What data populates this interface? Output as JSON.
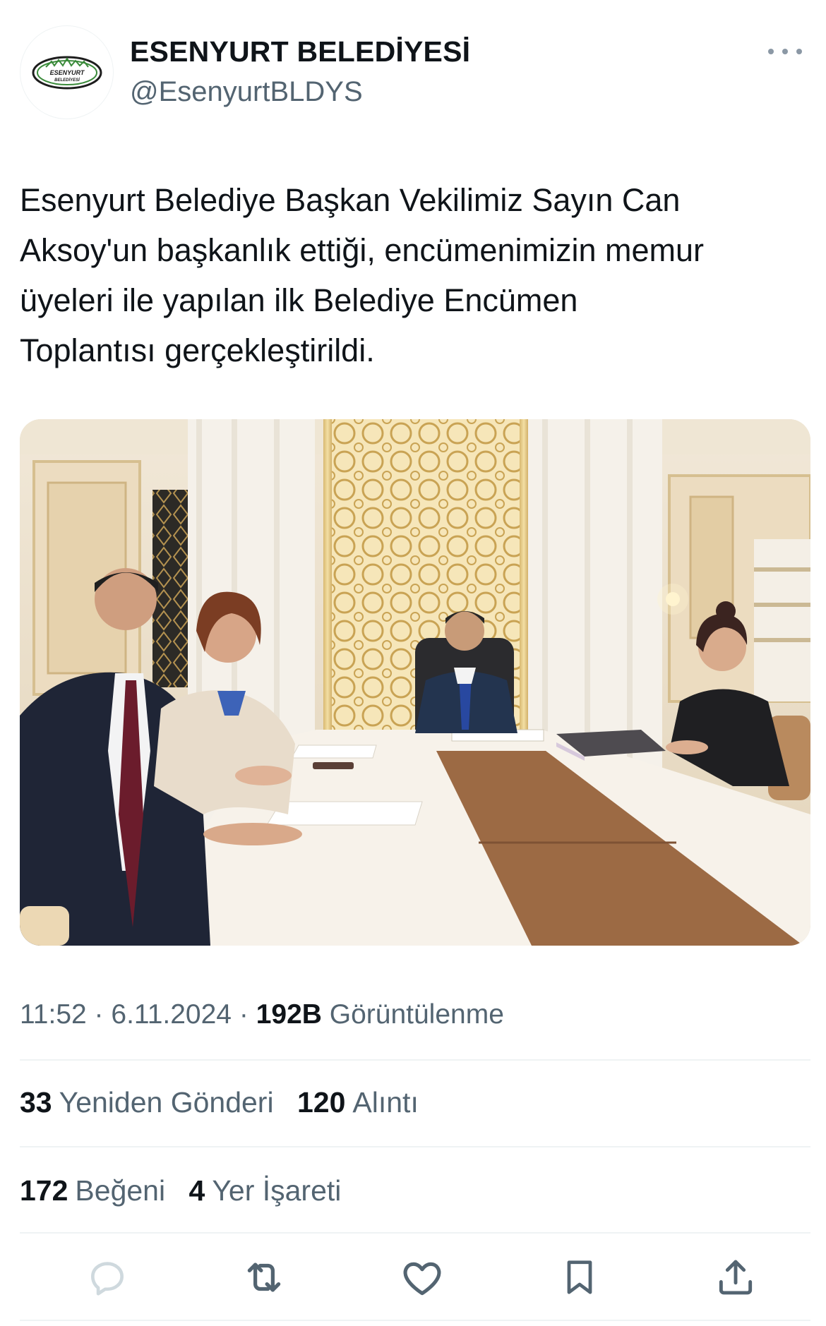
{
  "author": {
    "display_name": "ESENYURT BELEDİYESİ",
    "handle": "@EsenyurtBLDYS",
    "avatar_logo_line1": "ESENYURT",
    "avatar_logo_line2": "BELEDİYESİ"
  },
  "tweet": {
    "text": "Esenyurt Belediye Başkan Vekilimiz Sayın Can\nAksoy'un başkanlık ettiği, encümenimizin memur\nüyeleri ile yapılan ilk Belediye Encümen\nToplantısı gerçekleştirildi."
  },
  "meta": {
    "time": "11:52",
    "sep1": "·",
    "date": "6.11.2024",
    "sep2": "·",
    "views_count": "192B",
    "views_label": "Görüntülenme"
  },
  "stats": {
    "reposts_count": "33",
    "reposts_label": "Yeniden Gönderi",
    "quotes_count": "120",
    "quotes_label": "Alıntı",
    "likes_count": "172",
    "likes_label": "Beğeni",
    "bookmarks_count": "4",
    "bookmarks_label": "Yer İşareti"
  },
  "actions": [
    "reply-icon",
    "retweet-icon",
    "heart-icon",
    "bookmark-icon",
    "share-icon"
  ],
  "colors": {
    "text_primary": "#0f1419",
    "text_secondary": "#536471",
    "divider": "#eff3f4",
    "icon_gray": "#536471",
    "reply_icon_faded": "#cfd9de"
  }
}
